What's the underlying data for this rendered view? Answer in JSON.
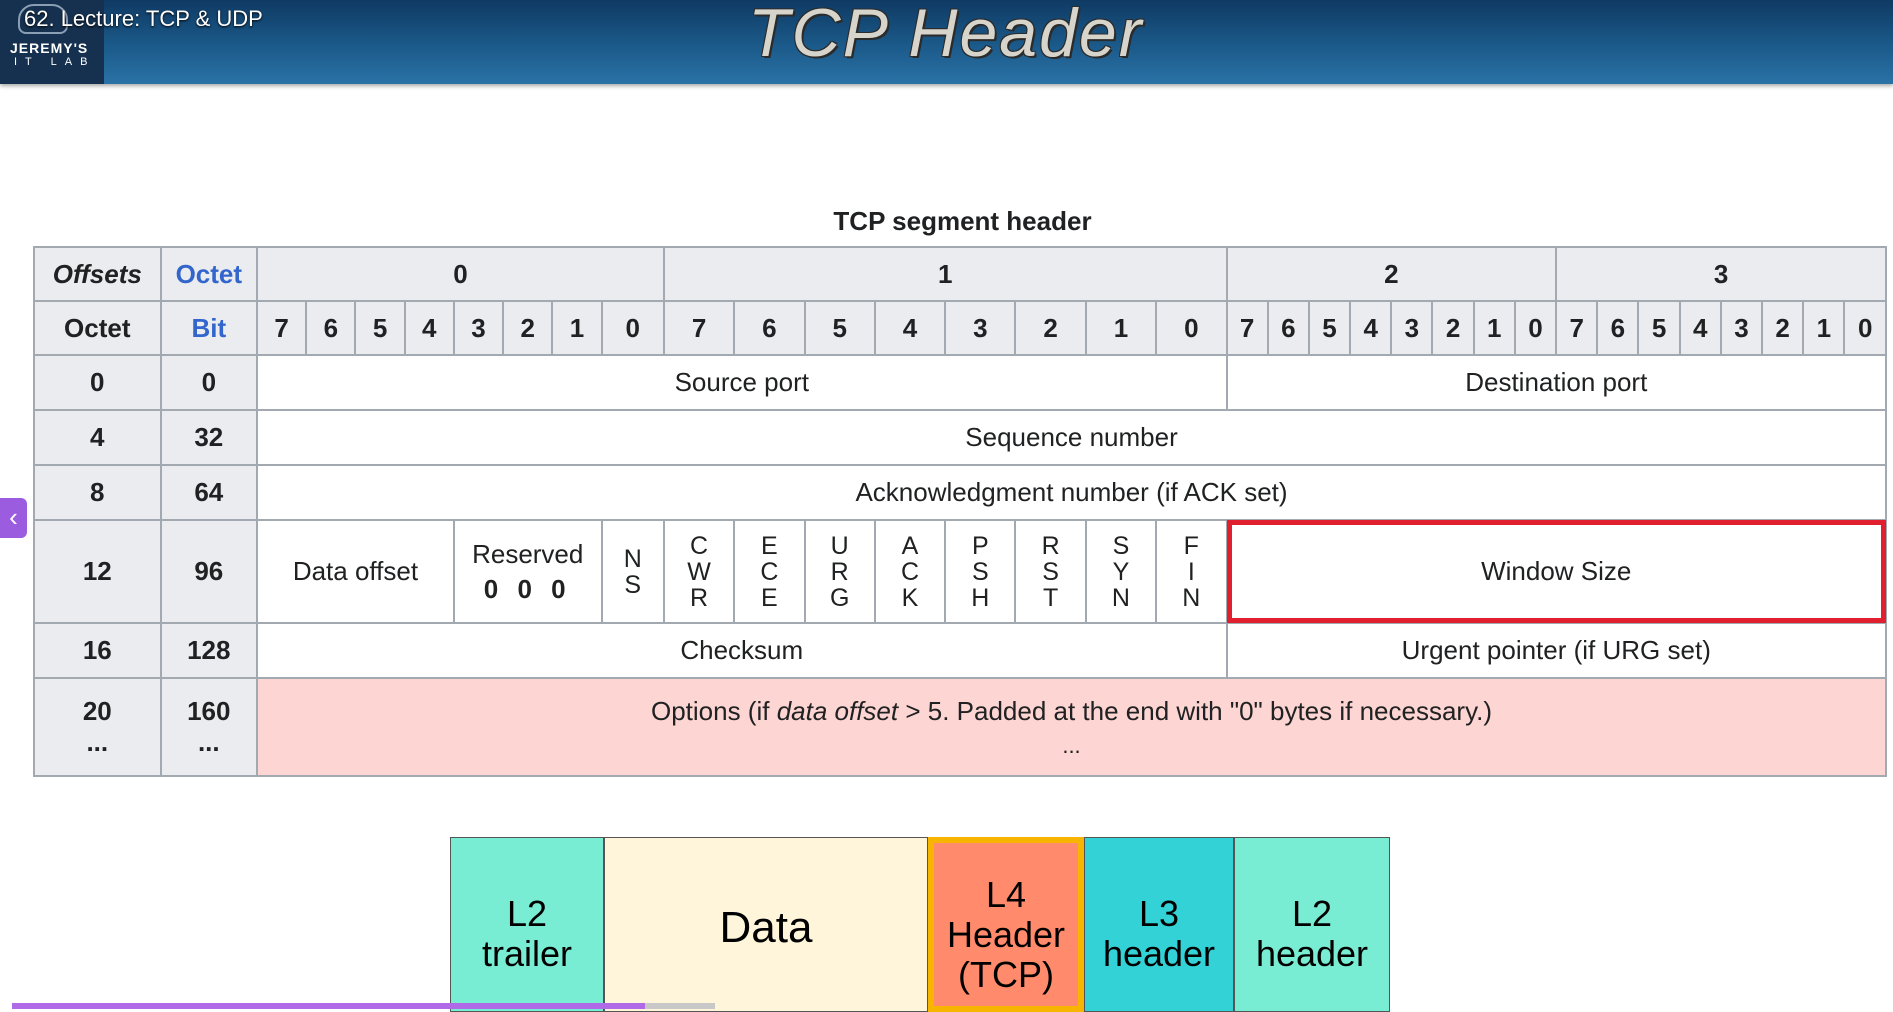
{
  "header": {
    "video_title": "62. Lecture: TCP & UDP",
    "logo_line1": "JEREMY'S",
    "logo_line2": "IT LAB",
    "slide_title": "TCP Header"
  },
  "table": {
    "caption": "TCP segment header",
    "corner_offsets": "Offsets",
    "corner_octet_top": "Octet",
    "corner_octet_left": "Octet",
    "corner_bit": "Bit",
    "octet_headers": [
      "0",
      "1",
      "2",
      "3"
    ],
    "bit_headers": [
      "7",
      "6",
      "5",
      "4",
      "3",
      "2",
      "1",
      "0",
      "7",
      "6",
      "5",
      "4",
      "3",
      "2",
      "1",
      "0",
      "7",
      "6",
      "5",
      "4",
      "3",
      "2",
      "1",
      "0",
      "7",
      "6",
      "5",
      "4",
      "3",
      "2",
      "1",
      "0"
    ],
    "rows": [
      {
        "octet": "0",
        "bit": "0"
      },
      {
        "octet": "4",
        "bit": "32"
      },
      {
        "octet": "8",
        "bit": "64"
      },
      {
        "octet": "12",
        "bit": "96"
      },
      {
        "octet": "16",
        "bit": "128"
      },
      {
        "octet": "20",
        "bit": "160",
        "octet_more": "...",
        "bit_more": "..."
      }
    ],
    "fields": {
      "source_port": "Source port",
      "destination_port": "Destination port",
      "sequence_number": "Sequence number",
      "ack_number": "Acknowledgment number (if ACK set)",
      "data_offset": "Data offset",
      "reserved": "Reserved",
      "reserved_bits": "0 0 0",
      "window_size": "Window Size",
      "checksum": "Checksum",
      "urgent_pointer": "Urgent pointer (if URG set)",
      "options_pre": "Options (if ",
      "options_em": "data offset",
      "options_post": " > 5. Padded at the end with \"0\" bytes if necessary.)",
      "options_more": "..."
    },
    "flags": [
      [
        "N",
        "S"
      ],
      [
        "C",
        "W",
        "R"
      ],
      [
        "E",
        "C",
        "E"
      ],
      [
        "U",
        "R",
        "G"
      ],
      [
        "A",
        "C",
        "K"
      ],
      [
        "P",
        "S",
        "H"
      ],
      [
        "R",
        "S",
        "T"
      ],
      [
        "S",
        "Y",
        "N"
      ],
      [
        "F",
        "I",
        "N"
      ]
    ],
    "highlight_color": "#e0202e"
  },
  "diagram": {
    "blocks": [
      {
        "label": "L2 trailer",
        "color": "#78edd4"
      },
      {
        "label": "Data",
        "color": "#fff5da"
      },
      {
        "label": "L4 Header (TCP)",
        "color": "#ff8a6c",
        "highlight": "#f7b500"
      },
      {
        "label": "L3 header",
        "color": "#33d2d6"
      },
      {
        "label": "L2 header",
        "color": "#78edd4"
      }
    ]
  },
  "player": {
    "nav_arrow": "chevron-left-icon",
    "progress_fraction": 0.9,
    "progress_color": "#b06ae8"
  }
}
